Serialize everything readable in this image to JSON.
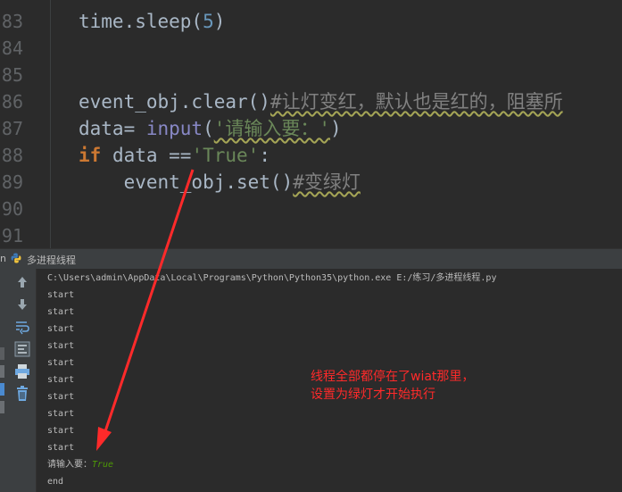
{
  "editor": {
    "lines": [
      {
        "num": "83",
        "code": "time.sleep(5)"
      },
      {
        "num": "84",
        "code": ""
      },
      {
        "num": "85",
        "code": ""
      },
      {
        "num": "86",
        "code": "event_obj.clear()#让灯变红，默认也是红的，阻塞所"
      },
      {
        "num": "87",
        "code": "data= input('请输入要：')"
      },
      {
        "num": "88",
        "code": "if data =='True':"
      },
      {
        "num": "89",
        "code": "    event_obj.set()#变绿灯"
      },
      {
        "num": "90",
        "code": ""
      },
      {
        "num": "91",
        "code": ""
      }
    ],
    "tokens": {
      "l83_fn": "time.sleep(",
      "l83_num": "5",
      "l83_end": ")",
      "l86_code": "event_obj.clear()",
      "l86_cmt": "#让灯变红，默认也是红的，阻塞所",
      "l87_pre": "data= ",
      "l87_bi": "input",
      "l87_open": "(",
      "l87_str": "'请输入要：'",
      "l87_close": ")",
      "l88_kw": "if",
      "l88_mid": " data ==",
      "l88_str": "'True'",
      "l88_end": ":",
      "l89_code": "    event_obj.set()",
      "l89_cmt": "#变绿灯"
    }
  },
  "run_panel": {
    "label": "n",
    "config_name": "多进程线程",
    "icons": [
      "up-arrow-icon",
      "down-arrow-icon",
      "soft-wrap-icon",
      "scroll-to-end-icon",
      "print-icon",
      "trash-icon"
    ]
  },
  "console": {
    "command": "C:\\Users\\admin\\AppData\\Local\\Programs\\Python\\Python35\\python.exe E:/练习/多进程线程.py",
    "lines": [
      "start",
      "start",
      "start",
      "start",
      "start",
      "start",
      "start",
      "start",
      "start",
      "start"
    ],
    "prompt": "请输入要：",
    "input_value": "True",
    "last": "end"
  },
  "annotation": {
    "line1": "线程全部都停在了wiat那里，",
    "line2": "设置为绿灯才开始执行",
    "color": "#ff2a2a"
  }
}
